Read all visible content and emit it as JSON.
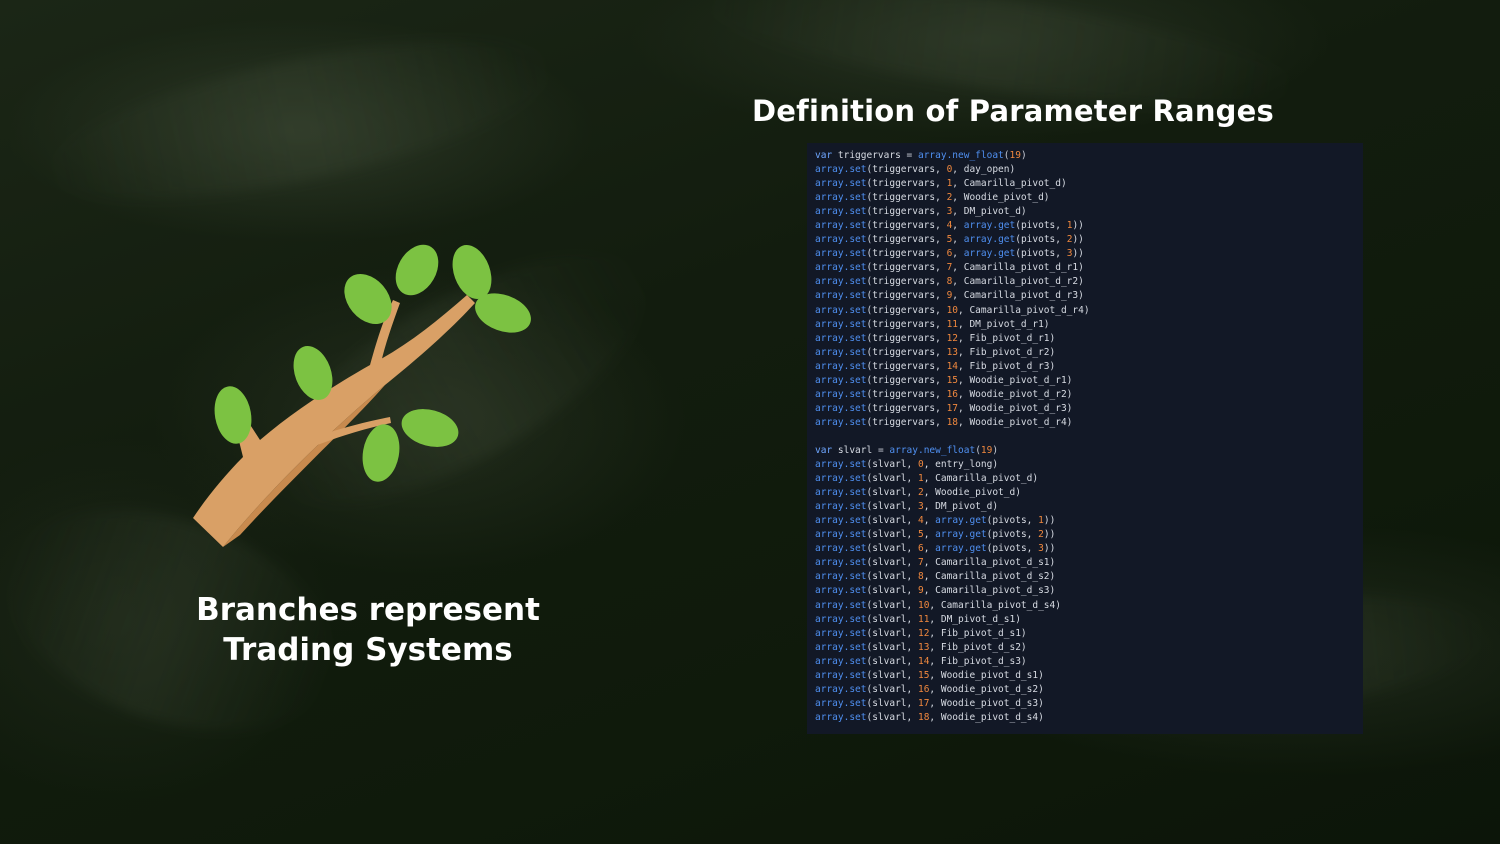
{
  "slide": {
    "title": "Definition of Parameter Ranges",
    "caption_line1": "Branches represent",
    "caption_line2": "Trading Systems"
  },
  "colors": {
    "background": "#111b0d",
    "code_bg": "#121826",
    "keyword": "#6ea6ff",
    "function": "#4f8ff0",
    "number": "#f0883e",
    "identifier": "#d7dbe3",
    "leaf": "#7cc242",
    "branch": "#d9a066"
  },
  "icons": [
    "tree-branch-icon"
  ],
  "code": {
    "lines": [
      [
        {
          "t": "var",
          "c": "kw"
        },
        {
          "t": " triggervars ",
          "c": "id"
        },
        {
          "t": "=",
          "c": "p"
        },
        {
          "t": " array.new_float",
          "c": "fn"
        },
        {
          "t": "(",
          "c": "p"
        },
        {
          "t": "19",
          "c": "num"
        },
        {
          "t": ")",
          "c": "p"
        }
      ],
      [
        {
          "t": "array.set",
          "c": "fn"
        },
        {
          "t": "(triggervars, ",
          "c": "id"
        },
        {
          "t": "0",
          "c": "num"
        },
        {
          "t": ", day_open)",
          "c": "id"
        }
      ],
      [
        {
          "t": "array.set",
          "c": "fn"
        },
        {
          "t": "(triggervars, ",
          "c": "id"
        },
        {
          "t": "1",
          "c": "num"
        },
        {
          "t": ", Camarilla_pivot_d)",
          "c": "id"
        }
      ],
      [
        {
          "t": "array.set",
          "c": "fn"
        },
        {
          "t": "(triggervars, ",
          "c": "id"
        },
        {
          "t": "2",
          "c": "num"
        },
        {
          "t": ", Woodie_pivot_d)",
          "c": "id"
        }
      ],
      [
        {
          "t": "array.set",
          "c": "fn"
        },
        {
          "t": "(triggervars, ",
          "c": "id"
        },
        {
          "t": "3",
          "c": "num"
        },
        {
          "t": ", DM_pivot_d)",
          "c": "id"
        }
      ],
      [
        {
          "t": "array.set",
          "c": "fn"
        },
        {
          "t": "(triggervars, ",
          "c": "id"
        },
        {
          "t": "4",
          "c": "num"
        },
        {
          "t": ", ",
          "c": "id"
        },
        {
          "t": "array.get",
          "c": "fn"
        },
        {
          "t": "(pivots, ",
          "c": "id"
        },
        {
          "t": "1",
          "c": "num"
        },
        {
          "t": "))",
          "c": "id"
        }
      ],
      [
        {
          "t": "array.set",
          "c": "fn"
        },
        {
          "t": "(triggervars, ",
          "c": "id"
        },
        {
          "t": "5",
          "c": "num"
        },
        {
          "t": ", ",
          "c": "id"
        },
        {
          "t": "array.get",
          "c": "fn"
        },
        {
          "t": "(pivots, ",
          "c": "id"
        },
        {
          "t": "2",
          "c": "num"
        },
        {
          "t": "))",
          "c": "id"
        }
      ],
      [
        {
          "t": "array.set",
          "c": "fn"
        },
        {
          "t": "(triggervars, ",
          "c": "id"
        },
        {
          "t": "6",
          "c": "num"
        },
        {
          "t": ", ",
          "c": "id"
        },
        {
          "t": "array.get",
          "c": "fn"
        },
        {
          "t": "(pivots, ",
          "c": "id"
        },
        {
          "t": "3",
          "c": "num"
        },
        {
          "t": "))",
          "c": "id"
        }
      ],
      [
        {
          "t": "array.set",
          "c": "fn"
        },
        {
          "t": "(triggervars, ",
          "c": "id"
        },
        {
          "t": "7",
          "c": "num"
        },
        {
          "t": ", Camarilla_pivot_d_r1)",
          "c": "id"
        }
      ],
      [
        {
          "t": "array.set",
          "c": "fn"
        },
        {
          "t": "(triggervars, ",
          "c": "id"
        },
        {
          "t": "8",
          "c": "num"
        },
        {
          "t": ", Camarilla_pivot_d_r2)",
          "c": "id"
        }
      ],
      [
        {
          "t": "array.set",
          "c": "fn"
        },
        {
          "t": "(triggervars, ",
          "c": "id"
        },
        {
          "t": "9",
          "c": "num"
        },
        {
          "t": ", Camarilla_pivot_d_r3)",
          "c": "id"
        }
      ],
      [
        {
          "t": "array.set",
          "c": "fn"
        },
        {
          "t": "(triggervars, ",
          "c": "id"
        },
        {
          "t": "10",
          "c": "num"
        },
        {
          "t": ", Camarilla_pivot_d_r4)",
          "c": "id"
        }
      ],
      [
        {
          "t": "array.set",
          "c": "fn"
        },
        {
          "t": "(triggervars, ",
          "c": "id"
        },
        {
          "t": "11",
          "c": "num"
        },
        {
          "t": ", DM_pivot_d_r1)",
          "c": "id"
        }
      ],
      [
        {
          "t": "array.set",
          "c": "fn"
        },
        {
          "t": "(triggervars, ",
          "c": "id"
        },
        {
          "t": "12",
          "c": "num"
        },
        {
          "t": ", Fib_pivot_d_r1)",
          "c": "id"
        }
      ],
      [
        {
          "t": "array.set",
          "c": "fn"
        },
        {
          "t": "(triggervars, ",
          "c": "id"
        },
        {
          "t": "13",
          "c": "num"
        },
        {
          "t": ", Fib_pivot_d_r2)",
          "c": "id"
        }
      ],
      [
        {
          "t": "array.set",
          "c": "fn"
        },
        {
          "t": "(triggervars, ",
          "c": "id"
        },
        {
          "t": "14",
          "c": "num"
        },
        {
          "t": ", Fib_pivot_d_r3)",
          "c": "id"
        }
      ],
      [
        {
          "t": "array.set",
          "c": "fn"
        },
        {
          "t": "(triggervars, ",
          "c": "id"
        },
        {
          "t": "15",
          "c": "num"
        },
        {
          "t": ", Woodie_pivot_d_r1)",
          "c": "id"
        }
      ],
      [
        {
          "t": "array.set",
          "c": "fn"
        },
        {
          "t": "(triggervars, ",
          "c": "id"
        },
        {
          "t": "16",
          "c": "num"
        },
        {
          "t": ", Woodie_pivot_d_r2)",
          "c": "id"
        }
      ],
      [
        {
          "t": "array.set",
          "c": "fn"
        },
        {
          "t": "(triggervars, ",
          "c": "id"
        },
        {
          "t": "17",
          "c": "num"
        },
        {
          "t": ", Woodie_pivot_d_r3)",
          "c": "id"
        }
      ],
      [
        {
          "t": "array.set",
          "c": "fn"
        },
        {
          "t": "(triggervars, ",
          "c": "id"
        },
        {
          "t": "18",
          "c": "num"
        },
        {
          "t": ", Woodie_pivot_d_r4)",
          "c": "id"
        }
      ],
      [],
      [
        {
          "t": "var",
          "c": "kw"
        },
        {
          "t": " slvarl ",
          "c": "id"
        },
        {
          "t": "=",
          "c": "p"
        },
        {
          "t": " array.new_float",
          "c": "fn"
        },
        {
          "t": "(",
          "c": "p"
        },
        {
          "t": "19",
          "c": "num"
        },
        {
          "t": ")",
          "c": "p"
        }
      ],
      [
        {
          "t": "array.set",
          "c": "fn"
        },
        {
          "t": "(slvarl, ",
          "c": "id"
        },
        {
          "t": "0",
          "c": "num"
        },
        {
          "t": ", entry_long)",
          "c": "id"
        }
      ],
      [
        {
          "t": "array.set",
          "c": "fn"
        },
        {
          "t": "(slvarl, ",
          "c": "id"
        },
        {
          "t": "1",
          "c": "num"
        },
        {
          "t": ", Camarilla_pivot_d)",
          "c": "id"
        }
      ],
      [
        {
          "t": "array.set",
          "c": "fn"
        },
        {
          "t": "(slvarl, ",
          "c": "id"
        },
        {
          "t": "2",
          "c": "num"
        },
        {
          "t": ", Woodie_pivot_d)",
          "c": "id"
        }
      ],
      [
        {
          "t": "array.set",
          "c": "fn"
        },
        {
          "t": "(slvarl, ",
          "c": "id"
        },
        {
          "t": "3",
          "c": "num"
        },
        {
          "t": ", DM_pivot_d)",
          "c": "id"
        }
      ],
      [
        {
          "t": "array.set",
          "c": "fn"
        },
        {
          "t": "(slvarl, ",
          "c": "id"
        },
        {
          "t": "4",
          "c": "num"
        },
        {
          "t": ", ",
          "c": "id"
        },
        {
          "t": "array.get",
          "c": "fn"
        },
        {
          "t": "(pivots, ",
          "c": "id"
        },
        {
          "t": "1",
          "c": "num"
        },
        {
          "t": "))",
          "c": "id"
        }
      ],
      [
        {
          "t": "array.set",
          "c": "fn"
        },
        {
          "t": "(slvarl, ",
          "c": "id"
        },
        {
          "t": "5",
          "c": "num"
        },
        {
          "t": ", ",
          "c": "id"
        },
        {
          "t": "array.get",
          "c": "fn"
        },
        {
          "t": "(pivots, ",
          "c": "id"
        },
        {
          "t": "2",
          "c": "num"
        },
        {
          "t": "))",
          "c": "id"
        }
      ],
      [
        {
          "t": "array.set",
          "c": "fn"
        },
        {
          "t": "(slvarl, ",
          "c": "id"
        },
        {
          "t": "6",
          "c": "num"
        },
        {
          "t": ", ",
          "c": "id"
        },
        {
          "t": "array.get",
          "c": "fn"
        },
        {
          "t": "(pivots, ",
          "c": "id"
        },
        {
          "t": "3",
          "c": "num"
        },
        {
          "t": "))",
          "c": "id"
        }
      ],
      [
        {
          "t": "array.set",
          "c": "fn"
        },
        {
          "t": "(slvarl, ",
          "c": "id"
        },
        {
          "t": "7",
          "c": "num"
        },
        {
          "t": ", Camarilla_pivot_d_s1)",
          "c": "id"
        }
      ],
      [
        {
          "t": "array.set",
          "c": "fn"
        },
        {
          "t": "(slvarl, ",
          "c": "id"
        },
        {
          "t": "8",
          "c": "num"
        },
        {
          "t": ", Camarilla_pivot_d_s2)",
          "c": "id"
        }
      ],
      [
        {
          "t": "array.set",
          "c": "fn"
        },
        {
          "t": "(slvarl, ",
          "c": "id"
        },
        {
          "t": "9",
          "c": "num"
        },
        {
          "t": ", Camarilla_pivot_d_s3)",
          "c": "id"
        }
      ],
      [
        {
          "t": "array.set",
          "c": "fn"
        },
        {
          "t": "(slvarl, ",
          "c": "id"
        },
        {
          "t": "10",
          "c": "num"
        },
        {
          "t": ", Camarilla_pivot_d_s4)",
          "c": "id"
        }
      ],
      [
        {
          "t": "array.set",
          "c": "fn"
        },
        {
          "t": "(slvarl, ",
          "c": "id"
        },
        {
          "t": "11",
          "c": "num"
        },
        {
          "t": ", DM_pivot_d_s1)",
          "c": "id"
        }
      ],
      [
        {
          "t": "array.set",
          "c": "fn"
        },
        {
          "t": "(slvarl, ",
          "c": "id"
        },
        {
          "t": "12",
          "c": "num"
        },
        {
          "t": ", Fib_pivot_d_s1)",
          "c": "id"
        }
      ],
      [
        {
          "t": "array.set",
          "c": "fn"
        },
        {
          "t": "(slvarl, ",
          "c": "id"
        },
        {
          "t": "13",
          "c": "num"
        },
        {
          "t": ", Fib_pivot_d_s2)",
          "c": "id"
        }
      ],
      [
        {
          "t": "array.set",
          "c": "fn"
        },
        {
          "t": "(slvarl, ",
          "c": "id"
        },
        {
          "t": "14",
          "c": "num"
        },
        {
          "t": ", Fib_pivot_d_s3)",
          "c": "id"
        }
      ],
      [
        {
          "t": "array.set",
          "c": "fn"
        },
        {
          "t": "(slvarl, ",
          "c": "id"
        },
        {
          "t": "15",
          "c": "num"
        },
        {
          "t": ", Woodie_pivot_d_s1)",
          "c": "id"
        }
      ],
      [
        {
          "t": "array.set",
          "c": "fn"
        },
        {
          "t": "(slvarl, ",
          "c": "id"
        },
        {
          "t": "16",
          "c": "num"
        },
        {
          "t": ", Woodie_pivot_d_s2)",
          "c": "id"
        }
      ],
      [
        {
          "t": "array.set",
          "c": "fn"
        },
        {
          "t": "(slvarl, ",
          "c": "id"
        },
        {
          "t": "17",
          "c": "num"
        },
        {
          "t": ", Woodie_pivot_d_s3)",
          "c": "id"
        }
      ],
      [
        {
          "t": "array.set",
          "c": "fn"
        },
        {
          "t": "(slvarl, ",
          "c": "id"
        },
        {
          "t": "18",
          "c": "num"
        },
        {
          "t": ", Woodie_pivot_d_s4)",
          "c": "id"
        }
      ]
    ]
  }
}
